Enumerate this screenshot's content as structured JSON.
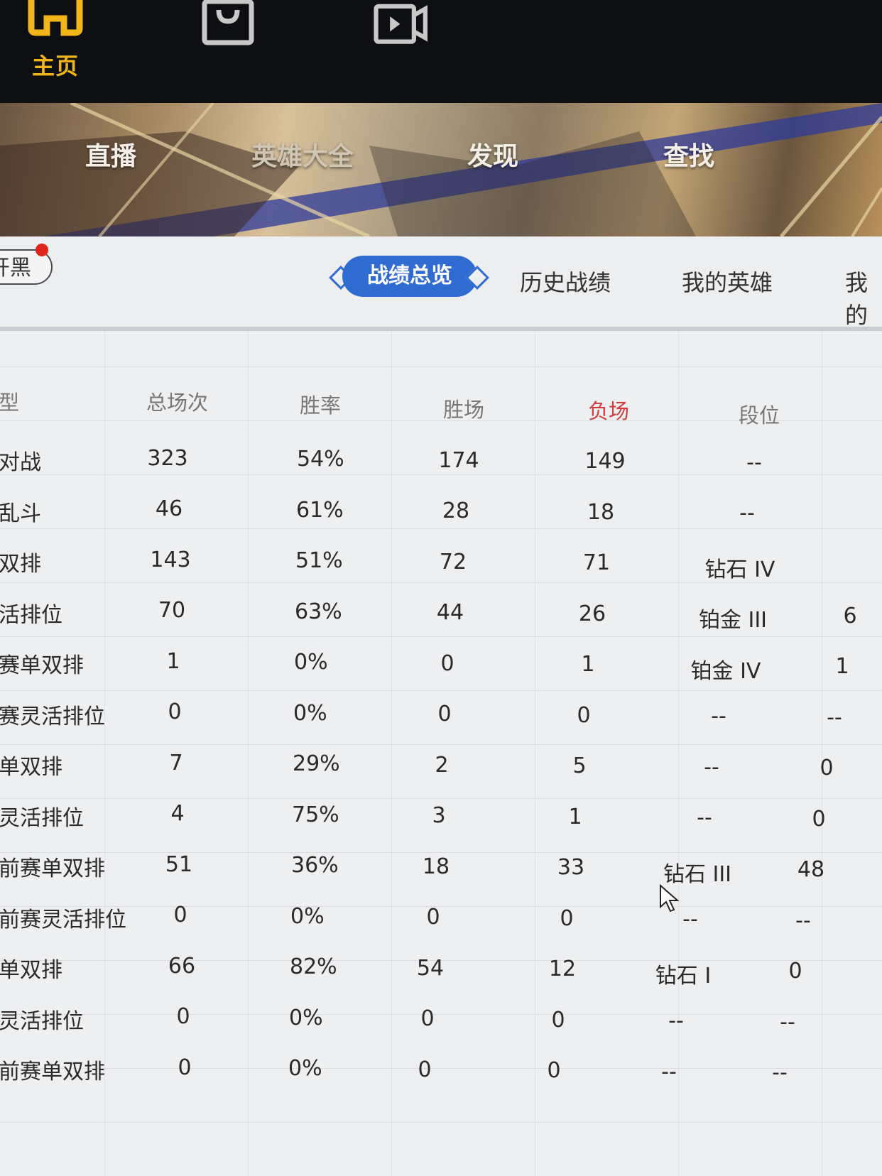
{
  "top_nav": {
    "items": [
      {
        "icon": "home-icon",
        "label": "主页",
        "active": true
      },
      {
        "icon": "bag-icon",
        "label": ""
      },
      {
        "icon": "video-icon",
        "label": ""
      }
    ],
    "accent": "#f0b619"
  },
  "banner": {
    "tabs": [
      "直播",
      "英雄大全",
      "发现",
      "查找"
    ]
  },
  "subtabs": {
    "left_button": "开黑",
    "active": "战绩总览",
    "others": [
      "历史战绩",
      "我的英雄",
      "我的"
    ]
  },
  "table": {
    "headers": {
      "mode": "型",
      "total": "总场次",
      "winrate": "胜率",
      "wins": "胜场",
      "losses": "负场",
      "rank": "段位"
    },
    "rows": [
      {
        "mode": "对战",
        "total": "323",
        "winrate": "54%",
        "wins": "174",
        "losses": "149",
        "rank": "--",
        "extra": ""
      },
      {
        "mode": "乱斗",
        "total": "46",
        "winrate": "61%",
        "wins": "28",
        "losses": "18",
        "rank": "--",
        "extra": ""
      },
      {
        "mode": "双排",
        "total": "143",
        "winrate": "51%",
        "wins": "72",
        "losses": "71",
        "rank": "钻石 IV",
        "extra": ""
      },
      {
        "mode": "活排位",
        "total": "70",
        "winrate": "63%",
        "wins": "44",
        "losses": "26",
        "rank": "铂金 III",
        "extra": "6"
      },
      {
        "mode": "赛单双排",
        "total": "1",
        "winrate": "0%",
        "wins": "0",
        "losses": "1",
        "rank": "铂金 IV",
        "extra": "1"
      },
      {
        "mode": "赛灵活排位",
        "total": "0",
        "winrate": "0%",
        "wins": "0",
        "losses": "0",
        "rank": "--",
        "extra": "--"
      },
      {
        "mode": "单双排",
        "total": "7",
        "winrate": "29%",
        "wins": "2",
        "losses": "5",
        "rank": "--",
        "extra": "0"
      },
      {
        "mode": "灵活排位",
        "total": "4",
        "winrate": "75%",
        "wins": "3",
        "losses": "1",
        "rank": "--",
        "extra": "0"
      },
      {
        "mode": "前赛单双排",
        "total": "51",
        "winrate": "36%",
        "wins": "18",
        "losses": "33",
        "rank": "钻石 III",
        "extra": "48"
      },
      {
        "mode": "前赛灵活排位",
        "total": "0",
        "winrate": "0%",
        "wins": "0",
        "losses": "0",
        "rank": "--",
        "extra": "--"
      },
      {
        "mode": "单双排",
        "total": "66",
        "winrate": "82%",
        "wins": "54",
        "losses": "12",
        "rank": "钻石 I",
        "extra": "0"
      },
      {
        "mode": "灵活排位",
        "total": "0",
        "winrate": "0%",
        "wins": "0",
        "losses": "0",
        "rank": "--",
        "extra": "--"
      },
      {
        "mode": "前赛单双排",
        "total": "0",
        "winrate": "0%",
        "wins": "0",
        "losses": "0",
        "rank": "--",
        "extra": "--"
      }
    ]
  },
  "colors": {
    "active_tab": "#2f6bd0",
    "loss_header": "#d23b3b",
    "notification": "#e1251b"
  }
}
